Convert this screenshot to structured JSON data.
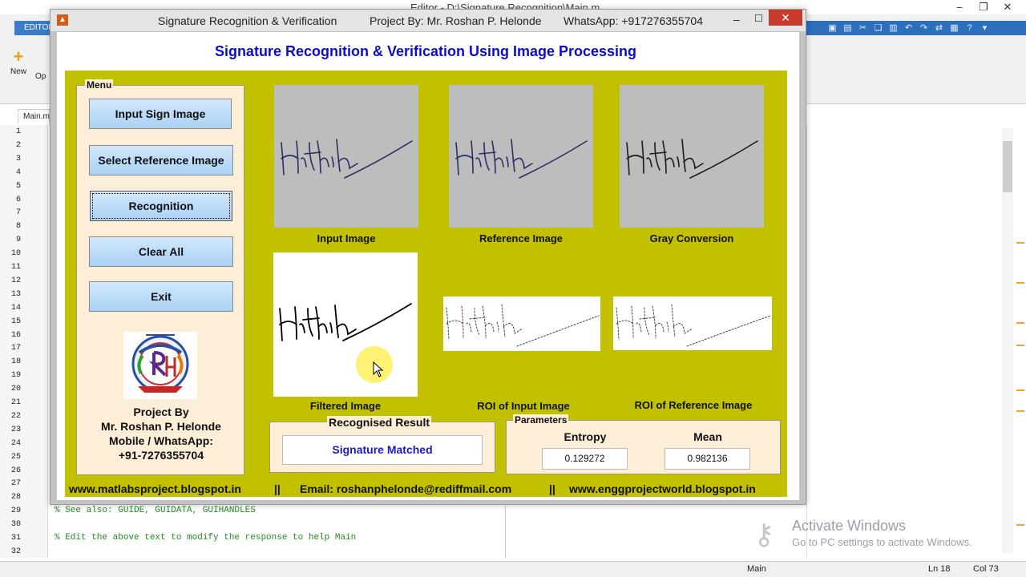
{
  "background_editor": {
    "title_text": "Editor - D:\\Signature Recognition\\Main.m",
    "tab_label": "EDITOR",
    "new_label": "New",
    "open_label": "Op",
    "file_tab": "Main.m",
    "line_numbers": [
      "1",
      "2",
      "3",
      "4",
      "5",
      "6",
      "7",
      "8",
      "9",
      "10",
      "11",
      "12",
      "13",
      "14",
      "15",
      "16",
      "17",
      "18",
      "19",
      "20",
      "21",
      "22",
      "23",
      "24",
      "25",
      "26",
      "27",
      "28",
      "29",
      "30",
      "31",
      "32"
    ],
    "code_lines": [
      "% See also: GUIDE, GUIDATA, GUIHANDLES",
      "% Edit the above text to modify the response to help Main"
    ],
    "status_main": "Main",
    "status_ln": "Ln   18",
    "status_col": "Col   73",
    "activate_title": "Activate Windows",
    "activate_sub": "Go to PC settings to activate Windows."
  },
  "window": {
    "title": "Signature Recognition & Verification",
    "project": "Project By: Mr. Roshan P. Helonde",
    "whatsapp": "WhatsApp: +917276355704"
  },
  "app": {
    "heading": "Signature Recognition & Verification Using Image Processing",
    "menu": {
      "label": "Menu",
      "buttons": [
        "Input Sign Image",
        "Select Reference Image",
        "Recognition",
        "Clear All",
        "Exit"
      ]
    },
    "project_by": [
      "Project By",
      "Mr. Roshan P. Helonde",
      "Mobile / WhatsApp:",
      "+91-7276355704"
    ],
    "images": {
      "input": "Input Image",
      "reference": "Reference Image",
      "gray": "Gray Conversion",
      "filtered": "Filtered Image",
      "roi_input": "ROI of Input Image",
      "roi_reference": "ROI of Reference Image"
    },
    "result": {
      "label": "Recognised Result",
      "value": "Signature Matched"
    },
    "parameters": {
      "label": "Parameters",
      "entropy_label": "Entropy",
      "entropy_value": "0.129272",
      "mean_label": "Mean",
      "mean_value": "0.982136"
    },
    "footer": {
      "site1": "www.matlabsproject.blogspot.in",
      "sep": "||",
      "email": "Email: roshanphelonde@rediffmail.com",
      "site2": "www.enggprojectworld.blogspot.in"
    }
  },
  "colors": {
    "panel_bg": "#c1c100",
    "heading": "#0c0cc8",
    "result_text": "#1919c8",
    "button_bg": "#a9d1f5",
    "panel_cream": "#fdeed7"
  }
}
